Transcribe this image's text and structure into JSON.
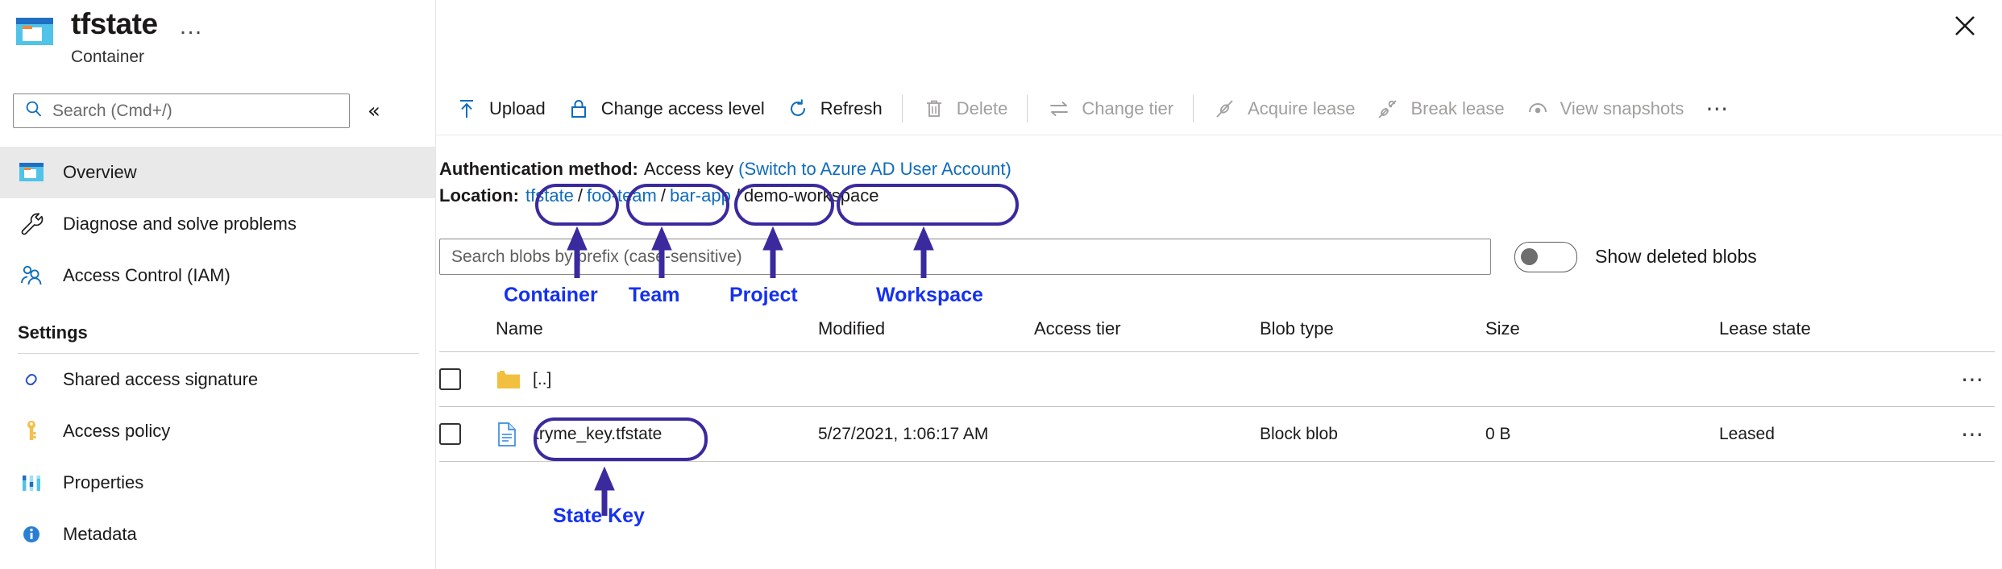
{
  "resource": {
    "title": "tfstate",
    "subtitle": "Container",
    "icon": "container-icon",
    "ellipsis": "…"
  },
  "sidebar": {
    "search": {
      "placeholder": "Search (Cmd+/)",
      "value": "",
      "icon": "search-icon"
    },
    "collapse_icon": "«",
    "items": [
      {
        "label": "Overview",
        "icon": "container-icon",
        "active": true
      },
      {
        "label": "Diagnose and solve problems",
        "icon": "wrench-icon",
        "active": false
      },
      {
        "label": "Access Control (IAM)",
        "icon": "people-icon",
        "active": false
      }
    ],
    "section_title": "Settings",
    "settings_items": [
      {
        "label": "Shared access signature",
        "icon": "link-icon"
      },
      {
        "label": "Access policy",
        "icon": "key-icon"
      },
      {
        "label": "Properties",
        "icon": "bars-icon"
      },
      {
        "label": "Metadata",
        "icon": "info-icon"
      }
    ]
  },
  "window": {
    "close_icon": "close-icon"
  },
  "toolbar": {
    "items": [
      {
        "label": "Upload",
        "icon": "upload-arrow-icon",
        "disabled": false
      },
      {
        "label": "Change access level",
        "icon": "lock-icon",
        "disabled": false
      },
      {
        "label": "Refresh",
        "icon": "refresh-icon",
        "disabled": false
      },
      {
        "label": "Delete",
        "icon": "trash-icon",
        "disabled": true
      },
      {
        "label": "Change tier",
        "icon": "swap-arrows-icon",
        "disabled": true
      },
      {
        "label": "Acquire lease",
        "icon": "lease-icon",
        "disabled": true
      },
      {
        "label": "Break lease",
        "icon": "break-lease-icon",
        "disabled": true
      },
      {
        "label": "View snapshots",
        "icon": "snapshot-icon",
        "disabled": true
      }
    ],
    "more_icon": "⋯"
  },
  "auth": {
    "label": "Authentication method:",
    "value": "Access key",
    "switch_link": "(Switch to Azure AD User Account)"
  },
  "location": {
    "label": "Location:",
    "separator": "/",
    "crumbs": [
      {
        "text": "tfstate",
        "current": false
      },
      {
        "text": "foo-team",
        "current": false
      },
      {
        "text": "bar-app",
        "current": false
      },
      {
        "text": "demo-workspace",
        "current": true
      }
    ]
  },
  "blob_search": {
    "placeholder": "Search blobs by prefix (case-sensitive)",
    "value": ""
  },
  "show_deleted": {
    "label": "Show deleted blobs",
    "on": false
  },
  "table": {
    "columns": [
      "Name",
      "Modified",
      "Access tier",
      "Blob type",
      "Size",
      "Lease state"
    ],
    "rows": [
      {
        "name": "[..]",
        "icon": "folder-icon",
        "modified": "",
        "access_tier": "",
        "blob_type": "",
        "size": "",
        "lease_state": "",
        "more": "⋯"
      },
      {
        "name": "tryme_key.tfstate",
        "icon": "file-icon",
        "modified": "5/27/2021, 1:06:17 AM",
        "access_tier": "",
        "blob_type": "Block blob",
        "size": "0 B",
        "lease_state": "Leased",
        "more": "⋯"
      }
    ]
  },
  "annotations": {
    "ring_color": "#3a2a9e",
    "label_color": "#1531f0",
    "callouts": [
      {
        "label": "Container"
      },
      {
        "label": "Team"
      },
      {
        "label": "Project"
      },
      {
        "label": "Workspace"
      },
      {
        "label": "State Key"
      }
    ]
  }
}
